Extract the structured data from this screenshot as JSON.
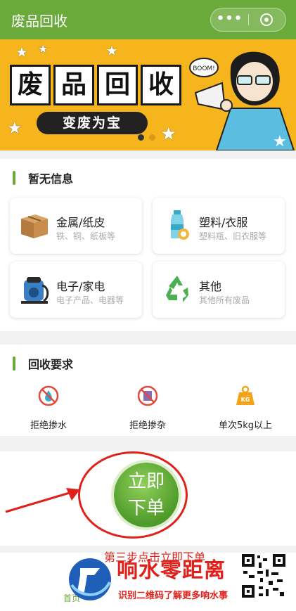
{
  "header": {
    "title": "废品回收",
    "more_glyph": "•••"
  },
  "banner": {
    "title_chars": [
      "废",
      "品",
      "回",
      "收"
    ],
    "slogan": "变废为宝",
    "bubble_text": "BOOM!",
    "dots": [
      true,
      false
    ]
  },
  "info_section": {
    "title": "暂无信息",
    "categories": [
      {
        "name": "金属/纸皮",
        "desc": "铁、铜、纸板等",
        "icon": "cardboard-box-icon"
      },
      {
        "name": "塑料/衣服",
        "desc": "塑料瓶、旧衣服等",
        "icon": "plastic-bottle-icon"
      },
      {
        "name": "电子/家电",
        "desc": "电子产品、电器等",
        "icon": "appliance-icon"
      },
      {
        "name": "其他",
        "desc": "其他所有废品",
        "icon": "recycle-icon"
      }
    ]
  },
  "requirements": {
    "title": "回收要求",
    "items": [
      {
        "label": "拒绝掺水",
        "icon": "no-water-icon"
      },
      {
        "label": "拒绝掺杂",
        "icon": "no-mixing-icon"
      },
      {
        "label": "单次5kg以上",
        "icon": "weight-kg-icon"
      }
    ],
    "kg_badge": "KG"
  },
  "order": {
    "line1": "立即",
    "line2": "下单"
  },
  "annotation": {
    "step_text": "第三步点击立即下单"
  },
  "bottom_nav": {
    "home_label": "首页"
  },
  "watermark": {
    "brand": "响水零距离",
    "subtitle": "识别二维码了解更多响水事"
  },
  "colors": {
    "brand_green": "#6aaa3a",
    "banner_yellow": "#f6b51c",
    "annotation_red": "#e0211b"
  }
}
